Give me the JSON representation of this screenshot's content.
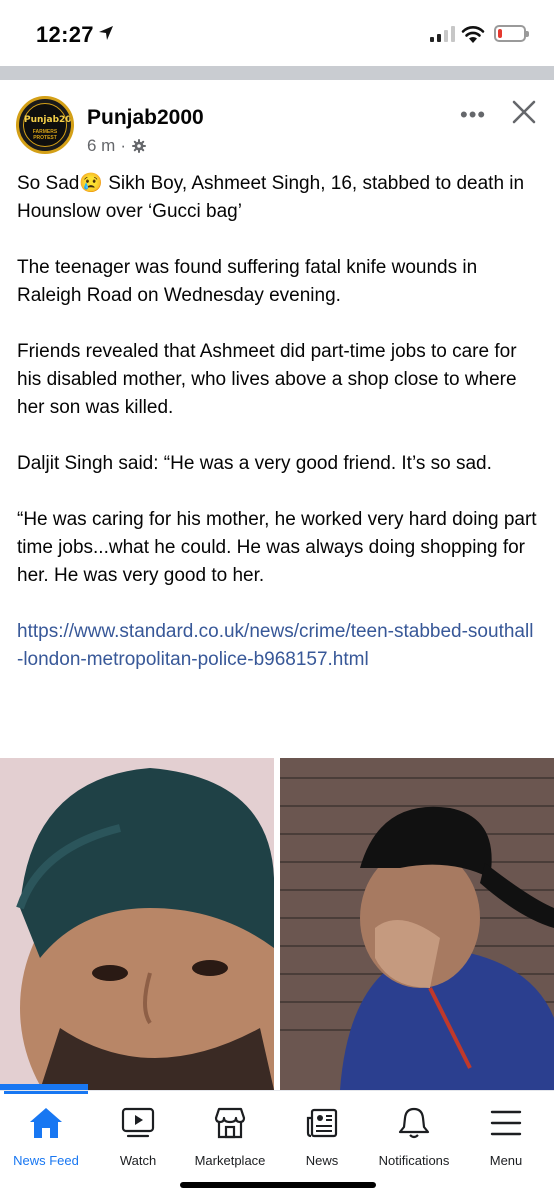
{
  "status_bar": {
    "time": "12:27",
    "battery_level": 0.18,
    "battery_color": "#e5382e"
  },
  "post": {
    "page_name": "Punjab2000",
    "avatar_logo_text": "Punjab2000",
    "avatar_sub_text": "FARMERS PROTEST",
    "time_ago": "6 m",
    "separator": "·",
    "paragraphs": [
      "So Sad😢 Sikh Boy, Ashmeet Singh, 16, stabbed to death in Hounslow over ‘Gucci bag’",
      "The teenager was found suffering fatal knife wounds in Raleigh Road on Wednesday evening.",
      "Friends revealed that Ashmeet did part-time jobs to care for his disabled mother, who lives above a shop close to where her son was killed.",
      "Daljit Singh said: “He was a very good friend. It’s so sad.",
      "“He was caring for his mother, he worked very hard doing part time jobs...what he could. He was always doing shopping for her. He was very good to her."
    ],
    "link": "https://www.standard.co.uk/news/crime/teen-stabbed-southall-london-metropolitan-police-b968157.html",
    "more_label": "•••"
  },
  "tabs": [
    {
      "label": "News Feed",
      "icon": "home-icon",
      "active": true
    },
    {
      "label": "Watch",
      "icon": "watch-icon",
      "active": false
    },
    {
      "label": "Marketplace",
      "icon": "marketplace-icon",
      "active": false
    },
    {
      "label": "News",
      "icon": "news-icon",
      "active": false
    },
    {
      "label": "Notifications",
      "icon": "bell-icon",
      "active": false
    },
    {
      "label": "Menu",
      "icon": "menu-icon",
      "active": false
    }
  ],
  "colors": {
    "accent": "#1877f2",
    "link": "#385898",
    "meta": "#65676b"
  }
}
